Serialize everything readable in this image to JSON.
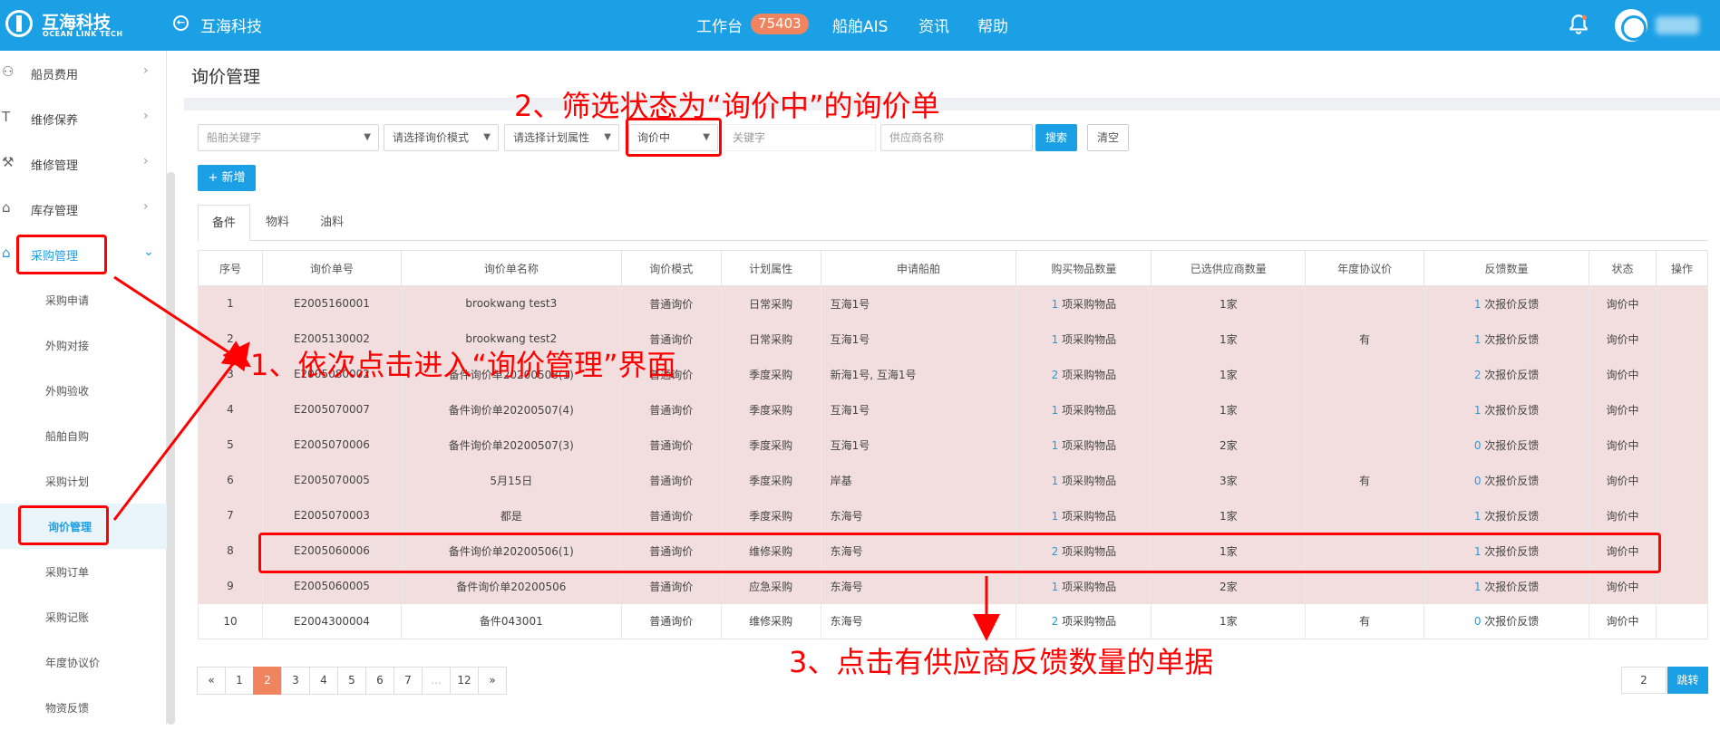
{
  "header": {
    "logo_title": "互海科技",
    "logo_subtitle": "OCEAN LINK TECH",
    "page_title": "互海科技",
    "nav": [
      {
        "label": "工作台",
        "badge": "75403"
      },
      {
        "label": "船舶AIS"
      },
      {
        "label": "资讯"
      },
      {
        "label": "帮助"
      }
    ]
  },
  "sidebar": {
    "items": [
      {
        "label": "船员费用",
        "icon": "user-icon"
      },
      {
        "label": "维修保养",
        "icon": "hammer-icon"
      },
      {
        "label": "维修管理",
        "icon": "wrench-icon"
      },
      {
        "label": "库存管理",
        "icon": "bag-icon"
      },
      {
        "label": "采购管理",
        "icon": "lock-icon"
      }
    ],
    "sub_items": [
      "采购申请",
      "外购对接",
      "外购验收",
      "船舶自购",
      "采购计划",
      "询价管理",
      "采购订单",
      "采购记账",
      "年度协议价",
      "物资反馈"
    ],
    "active_sub": "询价管理"
  },
  "main": {
    "title": "询价管理",
    "filters": {
      "ship_placeholder": "船舶关键字",
      "mode_placeholder": "请选择询价模式",
      "plan_placeholder": "请选择计划属性",
      "status_value": "询价中",
      "keyword_placeholder": "关键字",
      "supplier_placeholder": "供应商名称",
      "search_label": "搜索",
      "clear_label": "清空"
    },
    "add_label": "+ 新增",
    "tabs": [
      "备件",
      "物料",
      "油料"
    ],
    "table": {
      "headers": [
        "序号",
        "询价单号",
        "询价单名称",
        "询价模式",
        "计划属性",
        "申请船舶",
        "购买物品数量",
        "已选供应商数量",
        "年度协议价",
        "反馈数量",
        "状态",
        "操作"
      ],
      "rows": [
        {
          "no": "1",
          "code": "E2005160001",
          "name": "brookwang test3",
          "mode": "普通询价",
          "plan": "日常采购",
          "ship": "互海1号",
          "items_num": "1",
          "items_text": " 项采购物品",
          "suppliers": "1家",
          "annual": "",
          "fb_num": "1",
          "fb_text": " 次报价反馈",
          "status": "询价中"
        },
        {
          "no": "2",
          "code": "E2005130002",
          "name": "brookwang test2",
          "mode": "普通询价",
          "plan": "日常采购",
          "ship": "互海1号",
          "items_num": "1",
          "items_text": " 项采购物品",
          "suppliers": "1家",
          "annual": "有",
          "fb_num": "1",
          "fb_text": " 次报价反馈",
          "status": "询价中"
        },
        {
          "no": "3",
          "code": "E2005080002",
          "name": "备件询价单20200508(1)",
          "mode": "普通询价",
          "plan": "季度采购",
          "ship": "新海1号, 互海1号",
          "items_num": "2",
          "items_text": " 项采购物品",
          "suppliers": "1家",
          "annual": "",
          "fb_num": "2",
          "fb_text": " 次报价反馈",
          "status": "询价中"
        },
        {
          "no": "4",
          "code": "E2005070007",
          "name": "备件询价单20200507(4)",
          "mode": "普通询价",
          "plan": "季度采购",
          "ship": "互海1号",
          "items_num": "1",
          "items_text": " 项采购物品",
          "suppliers": "1家",
          "annual": "",
          "fb_num": "1",
          "fb_text": " 次报价反馈",
          "status": "询价中"
        },
        {
          "no": "5",
          "code": "E2005070006",
          "name": "备件询价单20200507(3)",
          "mode": "普通询价",
          "plan": "季度采购",
          "ship": "互海1号",
          "items_num": "1",
          "items_text": " 项采购物品",
          "suppliers": "2家",
          "annual": "",
          "fb_num": "0",
          "fb_text": " 次报价反馈",
          "status": "询价中"
        },
        {
          "no": "6",
          "code": "E2005070005",
          "name": "5月15日",
          "mode": "普通询价",
          "plan": "季度采购",
          "ship": "岸基",
          "items_num": "1",
          "items_text": " 项采购物品",
          "suppliers": "3家",
          "annual": "有",
          "fb_num": "0",
          "fb_text": " 次报价反馈",
          "status": "询价中"
        },
        {
          "no": "7",
          "code": "E2005070003",
          "name": "都是",
          "mode": "普通询价",
          "plan": "季度采购",
          "ship": "东海号",
          "items_num": "1",
          "items_text": " 项采购物品",
          "suppliers": "1家",
          "annual": "",
          "fb_num": "1",
          "fb_text": " 次报价反馈",
          "status": "询价中"
        },
        {
          "no": "8",
          "code": "E2005060006",
          "name": "备件询价单20200506(1)",
          "mode": "普通询价",
          "plan": "维修采购",
          "ship": "东海号",
          "items_num": "2",
          "items_text": " 项采购物品",
          "suppliers": "1家",
          "annual": "",
          "fb_num": "1",
          "fb_text": " 次报价反馈",
          "status": "询价中"
        },
        {
          "no": "9",
          "code": "E2005060005",
          "name": "备件询价单20200506",
          "mode": "普通询价",
          "plan": "应急采购",
          "ship": "东海号",
          "items_num": "1",
          "items_text": " 项采购物品",
          "suppliers": "2家",
          "annual": "",
          "fb_num": "1",
          "fb_text": " 次报价反馈",
          "status": "询价中"
        },
        {
          "no": "10",
          "code": "E2004300004",
          "name": "备件043001",
          "mode": "普通询价",
          "plan": "维修采购",
          "ship": "东海号",
          "items_num": "2",
          "items_text": " 项采购物品",
          "suppliers": "1家",
          "annual": "有",
          "fb_num": "0",
          "fb_text": " 次报价反馈",
          "status": "询价中"
        }
      ]
    },
    "pagination": {
      "prev": "«",
      "pages": [
        "1",
        "2",
        "3",
        "4",
        "5",
        "6",
        "7",
        "...",
        "12"
      ],
      "current": "2",
      "next": "»",
      "jump_value": "2",
      "jump_label": "跳转"
    }
  },
  "annotations": {
    "step1": "1、依次点击进入“询价管理”界面",
    "step2": "2、筛选状态为“询价中”的询价单",
    "step3": "3、点击有供应商反馈数量的单据"
  },
  "colors": {
    "primary": "#1ba0e6",
    "badge": "#f0845f",
    "highlight_row": "#f2dede",
    "annotation": "#ff0000"
  }
}
